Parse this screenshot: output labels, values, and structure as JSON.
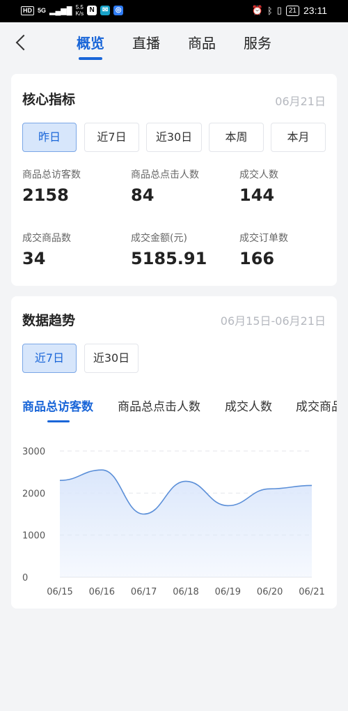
{
  "status_bar": {
    "hd": "HD",
    "signal": "5G",
    "speed_value": "5.5",
    "speed_unit": "K/s",
    "app_icons": [
      "N",
      "✉",
      "◎"
    ],
    "battery": "21",
    "time": "23:11"
  },
  "header": {
    "tabs": [
      "概览",
      "直播",
      "商品",
      "服务"
    ],
    "active_tab": "概览"
  },
  "core_metrics": {
    "title": "核心指标",
    "date": "06月21日",
    "ranges": [
      "昨日",
      "近7日",
      "近30日",
      "本周",
      "本月"
    ],
    "active_range": "昨日",
    "items": [
      {
        "label": "商品总访客数",
        "value": "2158"
      },
      {
        "label": "商品总点击人数",
        "value": "84"
      },
      {
        "label": "成交人数",
        "value": "144"
      },
      {
        "label": "成交商品数",
        "value": "34"
      },
      {
        "label": "成交金额(元)",
        "value": "5185.91"
      },
      {
        "label": "成交订单数",
        "value": "166"
      }
    ]
  },
  "trend": {
    "title": "数据趋势",
    "date_range": "06月15日-06月21日",
    "ranges": [
      "近7日",
      "近30日"
    ],
    "active_range": "近7日",
    "metric_tabs": [
      "商品总访客数",
      "商品总点击人数",
      "成交人数",
      "成交商品数"
    ],
    "active_metric": "商品总访客数"
  },
  "chart_data": {
    "type": "area",
    "categories": [
      "06/15",
      "06/16",
      "06/17",
      "06/18",
      "06/19",
      "06/20",
      "06/21"
    ],
    "values": [
      2300,
      2550,
      1500,
      2280,
      1700,
      2100,
      2180
    ],
    "ylim": [
      0,
      3000
    ],
    "yticks": [
      0,
      1000,
      2000,
      3000
    ],
    "grid": true,
    "line_color": "#5b8fd8",
    "fill_color": "#dbe7fb"
  },
  "colors": {
    "accent": "#1a66d8",
    "background": "#f3f4f6"
  }
}
